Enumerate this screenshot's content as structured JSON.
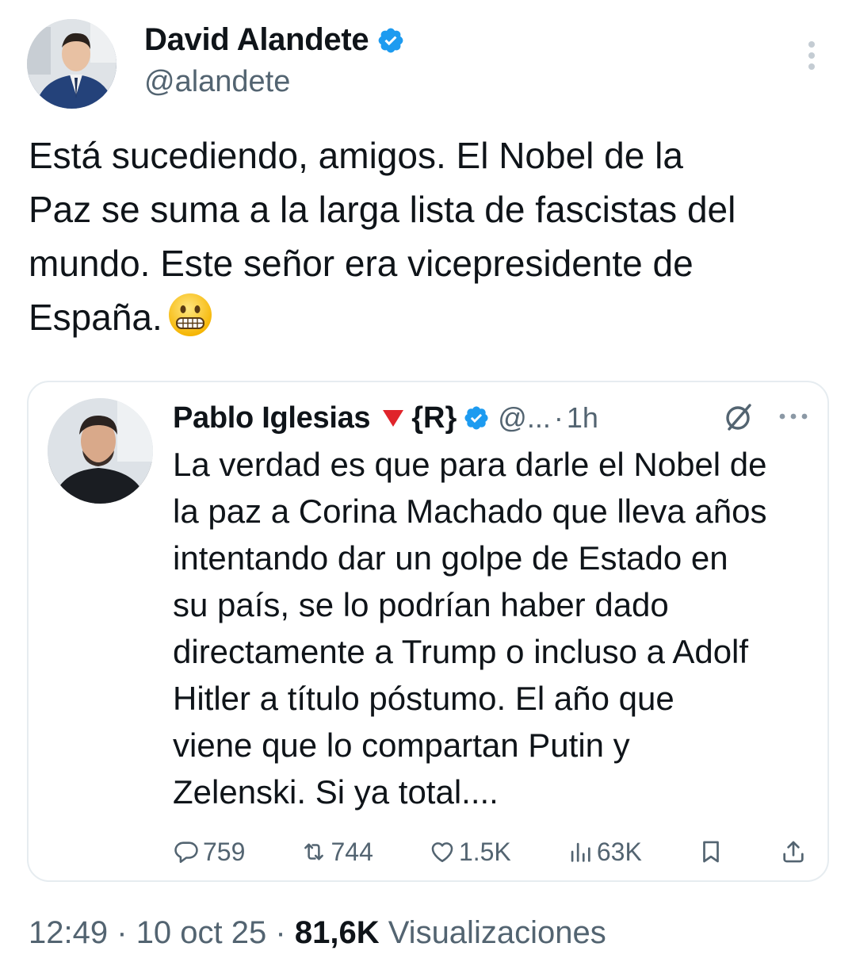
{
  "author": {
    "name": "David Alandete",
    "handle": "@alandete"
  },
  "tweet": {
    "lines": [
      "Está sucediendo, amigos. El Nobel de la",
      "Paz se suma a la larga lista de fascistas del",
      "mundo. Este señor era vicepresidente de",
      "España."
    ],
    "emoji": "grimacing-face"
  },
  "quote": {
    "name": "Pablo Iglesias",
    "name_suffix": "{R}",
    "handle": "@...",
    "separator": "·",
    "time": "1h",
    "lines": [
      "La verdad es que para darle el Nobel de",
      "la paz a Corina Machado que lleva años",
      "intentando dar un golpe de Estado en",
      "su país, se lo podrían haber dado",
      "directamente a Trump o incluso a Adolf",
      "Hitler a título póstumo. El año que",
      "viene que lo compartan Putin y",
      "Zelenski. Si ya total...."
    ],
    "metrics": {
      "replies": "759",
      "reposts": "744",
      "likes": "1.5K",
      "views": "63K"
    }
  },
  "footer": {
    "time": "12:49",
    "sep1": "·",
    "date": "10 oct 25",
    "sep2": "·",
    "views_count": "81,6K",
    "views_label": "Visualizaciones"
  },
  "colors": {
    "verified_blue": "#1d9bf0",
    "text_primary": "#0f1419",
    "text_secondary": "#536471",
    "border": "#e6ecf0",
    "triangle_red": "#e0242b"
  },
  "icons": {
    "more_vertical": "more-vertical-icon",
    "more_horizontal": "more-horizontal-icon",
    "grok": "grok-icon",
    "reply": "reply-icon",
    "repost": "repost-icon",
    "like": "heart-icon",
    "views": "views-icon",
    "bookmark": "bookmark-icon",
    "share": "share-icon"
  }
}
